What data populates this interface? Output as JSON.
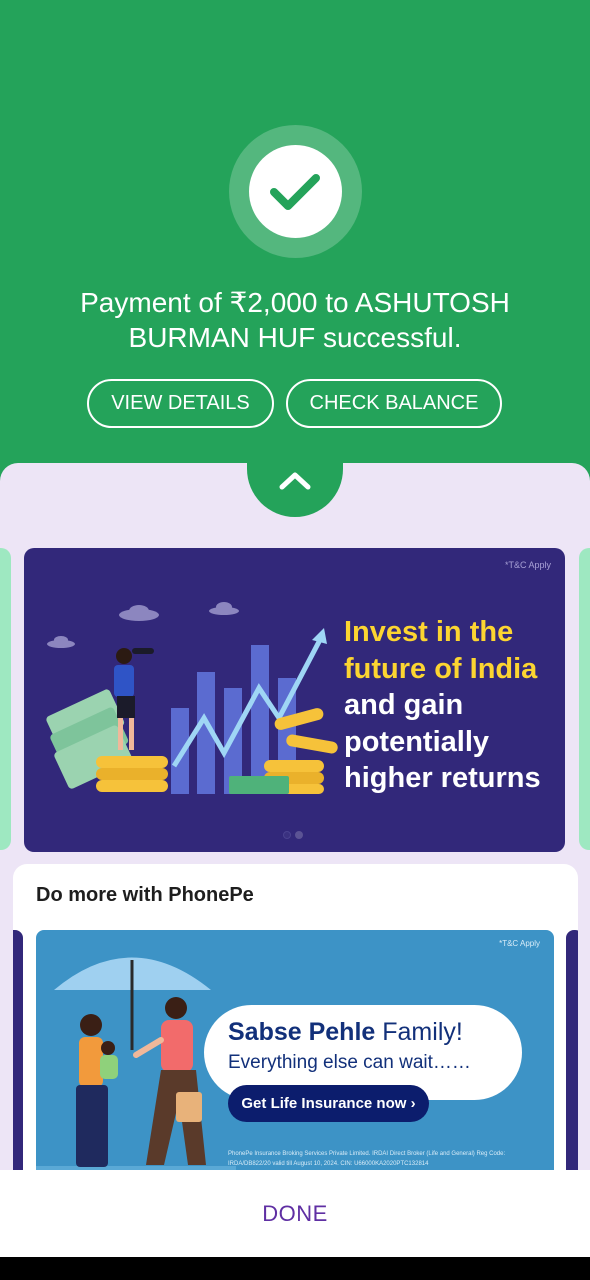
{
  "success": {
    "message": "Payment of ₹2,000 to ASHUTOSH BURMAN HUF successful.",
    "check_icon": "check-icon",
    "view_details_label": "VIEW DETAILS",
    "check_balance_label": "CHECK BALANCE"
  },
  "banner_invest": {
    "tnc": "*T&C Apply",
    "headline_yellow_line1": "Invest in the",
    "headline_yellow_line2": "future of India",
    "headline_white_line1": "and gain",
    "headline_white_line2": "potentially",
    "headline_white_line3": "higher returns",
    "carousel_active_index": 1,
    "carousel_count": 2
  },
  "more_section": {
    "title": "Do more with PhonePe"
  },
  "banner_insurance": {
    "tnc": "*T&C Apply",
    "heading_bold": "Sabse Pehle",
    "heading_rest": " Family!",
    "subheading": "Everything else can wait……",
    "cta_label": "Get Life Insurance now ›",
    "fine_print": "PhonePe Insurance Broking Services Private Limited. IRDAI Direct Broker (Life and General) Reg Code: IRDA/DB822/20 valid till August 10, 2024. CIN: U66000KA2020PTC132814"
  },
  "footer": {
    "done_label": "DONE"
  },
  "colors": {
    "success_green": "#24a35a",
    "sheet_bg": "#ede5f6",
    "invest_banner_bg": "#32287a",
    "insurance_banner_bg": "#3d93c6",
    "done_purple": "#5f2fa3"
  }
}
